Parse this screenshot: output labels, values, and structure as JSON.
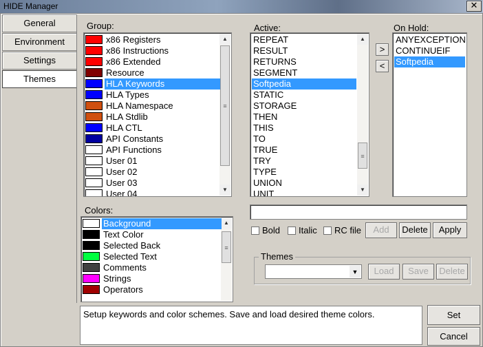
{
  "window": {
    "title": "HIDE Manager",
    "close_label": "✕"
  },
  "tabs": [
    {
      "label": "General"
    },
    {
      "label": "Environment"
    },
    {
      "label": "Settings"
    },
    {
      "label": "Themes"
    }
  ],
  "group": {
    "label": "Group:",
    "items": [
      {
        "label": "x86 Registers",
        "color": "#ff0000"
      },
      {
        "label": "x86 Instructions",
        "color": "#ff0000"
      },
      {
        "label": "x86 Extended",
        "color": "#ff0000"
      },
      {
        "label": "Resource",
        "color": "#800000"
      },
      {
        "label": "HLA Keywords",
        "color": "#0000ff",
        "selected": true
      },
      {
        "label": "HLA Types",
        "color": "#0000ff"
      },
      {
        "label": "HLA Namespace",
        "color": "#d05010"
      },
      {
        "label": "HLA Stdlib",
        "color": "#d05010"
      },
      {
        "label": "HLA CTL",
        "color": "#0000ff"
      },
      {
        "label": "API Constants",
        "color": "#0000a0"
      },
      {
        "label": "API Functions",
        "color": "#ffffff"
      },
      {
        "label": "User 01",
        "color": "#ffffff"
      },
      {
        "label": "User 02",
        "color": "#ffffff"
      },
      {
        "label": "User 03",
        "color": "#ffffff"
      },
      {
        "label": "User 04",
        "color": "#ffffff"
      }
    ]
  },
  "active": {
    "label": "Active:",
    "items": [
      "REPEAT",
      "RESULT",
      "RETURNS",
      "SEGMENT",
      "Softpedia",
      "STATIC",
      "STORAGE",
      "THEN",
      "THIS",
      "TO",
      "TRUE",
      "TRY",
      "TYPE",
      "UNION",
      "UNIT"
    ],
    "selected_index": 4
  },
  "move_right_label": ">",
  "move_left_label": "<",
  "onhold": {
    "label": "On Hold:",
    "items": [
      "ANYEXCEPTION",
      "CONTINUEIF",
      "Softpedia"
    ],
    "selected_index": 2
  },
  "colors": {
    "label": "Colors:",
    "items": [
      {
        "label": "Background",
        "color": "#ffffff",
        "selected": true
      },
      {
        "label": "Text Color",
        "color": "#000000"
      },
      {
        "label": "Selected Back",
        "color": "#000000"
      },
      {
        "label": "Selected Text",
        "color": "#00ff40"
      },
      {
        "label": "Comments",
        "color": "#404040"
      },
      {
        "label": "Strings",
        "color": "#ff00ff"
      },
      {
        "label": "Operators",
        "color": "#a00000"
      }
    ]
  },
  "keyword_input": {
    "value": ""
  },
  "options": {
    "bold_label": "Bold",
    "italic_label": "Italic",
    "rcfile_label": "RC file"
  },
  "buttons": {
    "add": "Add",
    "delete": "Delete",
    "apply": "Apply",
    "load": "Load",
    "save": "Save",
    "theme_delete": "Delete",
    "set": "Set",
    "cancel": "Cancel"
  },
  "themes": {
    "label": "Themes",
    "selected": ""
  },
  "description": "Setup keywords and color schemes.  Save and load desired theme colors."
}
